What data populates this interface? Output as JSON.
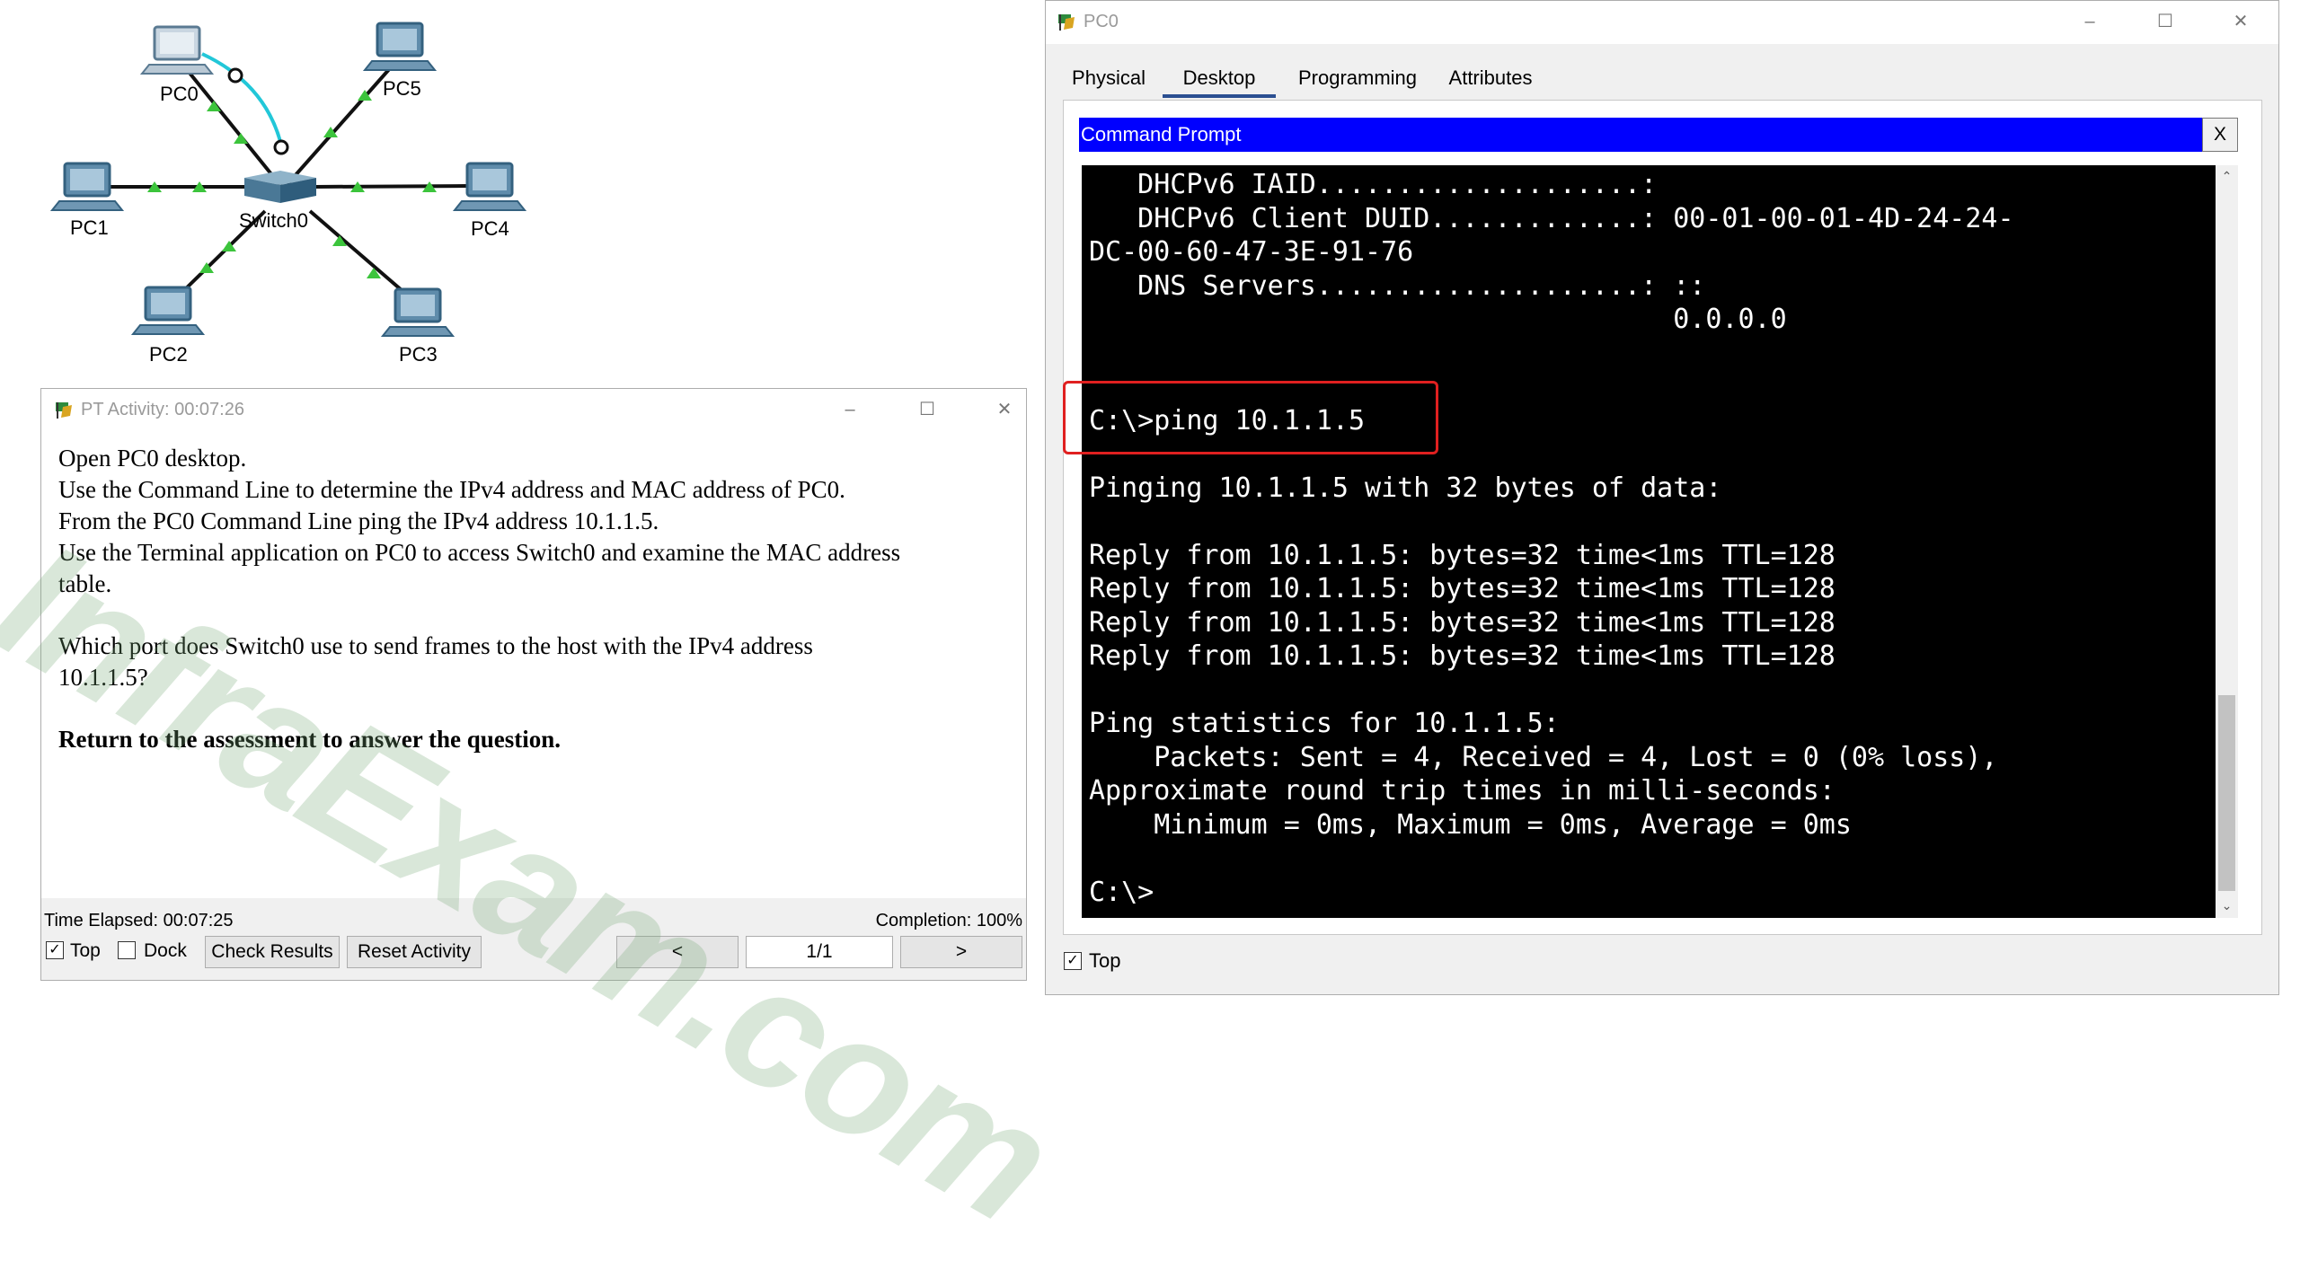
{
  "topology": {
    "devices": [
      "PC0",
      "PC5",
      "PC1",
      "Switch0",
      "PC4",
      "PC2",
      "PC3"
    ]
  },
  "watermark": "InfraExam.com",
  "activity": {
    "title": "PT Activity: 00:07:26",
    "lines": [
      "Open PC0 desktop.",
      "Use the Command Line to determine the IPv4 address and MAC address of PC0.",
      "From the PC0 Command Line ping the IPv4 address 10.1.1.5.",
      "Use the Terminal application on PC0 to access Switch0 and examine the MAC address",
      "table.",
      "Which port does Switch0 use to send frames to the host with the IPv4 address",
      "10.1.1.5?",
      "Return to the assessment to answer the question."
    ],
    "time_elapsed": "Time Elapsed: 00:07:25",
    "completion": "Completion: 100%",
    "top_label": "Top",
    "top_checked": true,
    "dock_label": "Dock",
    "dock_checked": false,
    "check_results": "Check Results",
    "reset_activity": "Reset Activity",
    "prev": "<",
    "page": "1/1",
    "next": ">"
  },
  "pc0": {
    "title": "PC0",
    "tabs": [
      "Physical",
      "Desktop",
      "Programming",
      "Attributes"
    ],
    "active_tab": "Desktop",
    "cmd_title": "Command Prompt",
    "cmd_close": "X",
    "terminal_lines": [
      "   DHCPv6 IAID....................:",
      "   DHCPv6 Client DUID.............: 00-01-00-01-4D-24-24-",
      "DC-00-60-47-3E-91-76",
      "   DNS Servers....................: ::",
      "                                    0.0.0.0",
      "",
      "",
      "C:\\>ping 10.1.1.5",
      "",
      "Pinging 10.1.1.5 with 32 bytes of data:",
      "",
      "Reply from 10.1.1.5: bytes=32 time<1ms TTL=128",
      "Reply from 10.1.1.5: bytes=32 time<1ms TTL=128",
      "Reply from 10.1.1.5: bytes=32 time<1ms TTL=128",
      "Reply from 10.1.1.5: bytes=32 time<1ms TTL=128",
      "",
      "Ping statistics for 10.1.1.5:",
      "    Packets: Sent = 4, Received = 4, Lost = 0 (0% loss),",
      "Approximate round trip times in milli-seconds:",
      "    Minimum = 0ms, Maximum = 0ms, Average = 0ms",
      "",
      "C:\\>"
    ],
    "top_label": "Top",
    "top_checked": true
  },
  "colors": {
    "cmd_bar": "#0000ff",
    "terminal_bg": "#000000",
    "terminal_fg": "#ffffff",
    "highlight": "#e02020",
    "link_green": "#3cc43c",
    "console_cable": "#22c7d8",
    "active_tab": "#2b4f91"
  }
}
